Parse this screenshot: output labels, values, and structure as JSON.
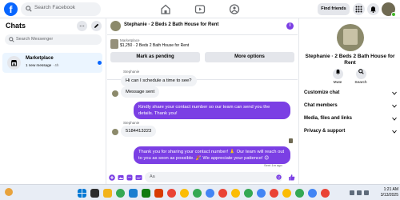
{
  "topbar": {
    "logo": "f",
    "search_placeholder": "Search Facebook",
    "find_friends_label": "Find friends",
    "nav_icons": [
      "home-icon",
      "video-icon",
      "groups-icon"
    ],
    "right_icons": [
      "menu-grid-icon",
      "messenger-icon",
      "bell-icon"
    ]
  },
  "chats": {
    "title": "Chats",
    "more_label": "...",
    "search_placeholder": "Search Messenger",
    "items": [
      {
        "name": "Marketplace",
        "subtitle": "1 new message",
        "time": "· 4h",
        "unread": true
      }
    ]
  },
  "conversation": {
    "header_title": "Stephanie · 2 Beds 2 Bath House for Rent",
    "info_label": "i",
    "listing": {
      "label": "Marketplace",
      "detail": "$1,250 · 2 Beds 2 Bath House for Rent",
      "buttons": [
        "Mark as pending",
        "More options"
      ]
    },
    "messages": [
      {
        "sender": "Stephanie",
        "text": "Hi can I schedule a time to see?",
        "direction": "in"
      },
      {
        "text": "Message sent",
        "direction": "in-status"
      },
      {
        "text": "Kindly share your contact number so our team can send you the details. Thank you!",
        "direction": "out"
      },
      {
        "sender": "Stephanie",
        "text": "5184413223",
        "direction": "in"
      },
      {
        "text": "Thank you for sharing your contact number! 🙏 Our team will reach out to you as soon as possible. 🎉 We appreciate your patience! 😊",
        "direction": "out"
      }
    ],
    "sent_time": "Sent 1m ago",
    "composer_placeholder": "Aa"
  },
  "info_panel": {
    "name": "Stephanie · 2 Beds 2 Bath House for Rent",
    "actions": [
      {
        "label": "Mute",
        "icon": "bell-icon"
      },
      {
        "label": "Search",
        "icon": "search-icon"
      }
    ],
    "sections": [
      "Customize chat",
      "Chat members",
      "Media, files and links",
      "Privacy & support"
    ]
  },
  "taskbar": {
    "time": "1:21 AM",
    "date": "3/13/2025",
    "accent": "#0866ff"
  },
  "colors": {
    "brand": "#0866ff",
    "outgoing_bubble": "#7b3fe4",
    "incoming_bubble": "#f0f2f5"
  }
}
